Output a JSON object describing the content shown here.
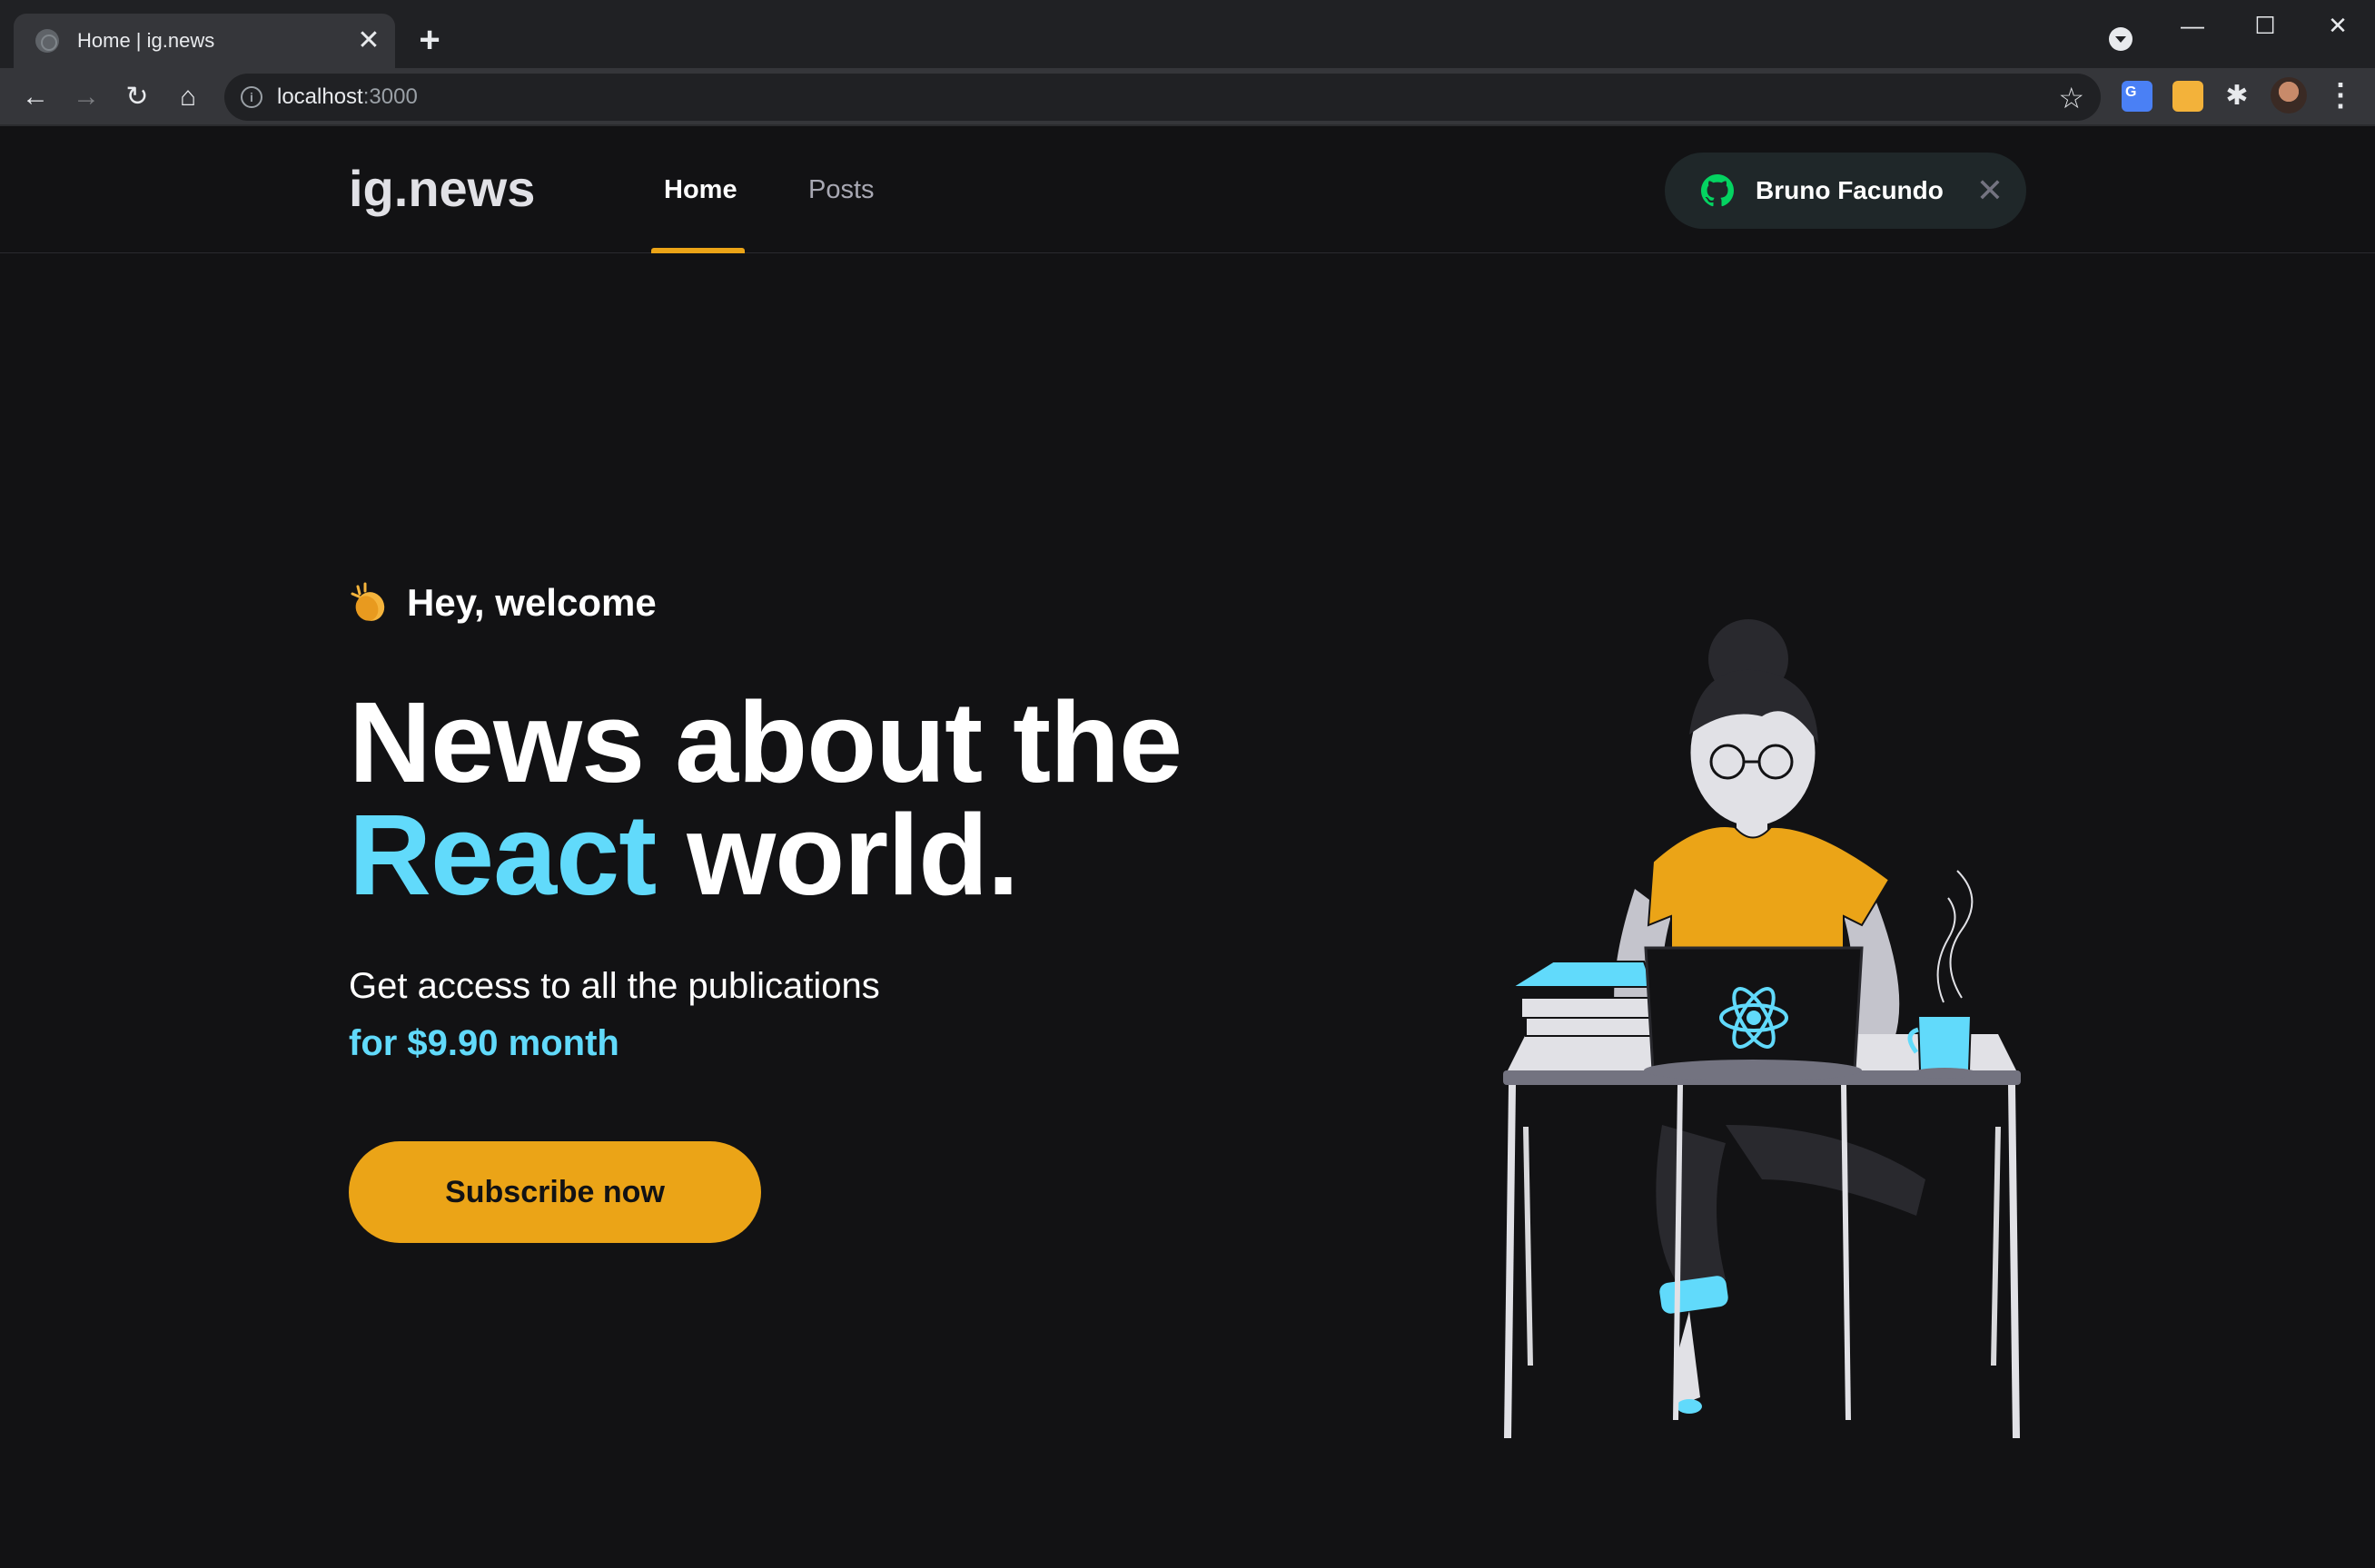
{
  "browser": {
    "tab_title": "Home | ig.news",
    "tab_close": "✕",
    "new_tab": "+",
    "url_host": "localhost",
    "url_port": ":3000",
    "window_minimize": "—",
    "window_maximize": "☐",
    "window_close": "✕"
  },
  "site": {
    "logo": "ig.news",
    "nav": [
      {
        "label": "Home",
        "active": true
      },
      {
        "label": "Posts",
        "active": false
      }
    ],
    "signin": {
      "user_name": "Bruno Facundo",
      "close": "✕"
    }
  },
  "hero": {
    "welcome": "Hey, welcome",
    "headline_line1": "News about the",
    "headline_accent": "React",
    "headline_line2_rest": " world.",
    "subtitle": "Get access to all the publications",
    "price": "for $9.90 month",
    "cta": "Subscribe now"
  },
  "colors": {
    "background": "#121214",
    "accent_yellow": "#eba417",
    "accent_cyan": "#61dafb",
    "github_green": "#04d361"
  },
  "icons": [
    "globe-icon",
    "back-icon",
    "forward-icon",
    "reload-icon",
    "home-icon",
    "info-icon",
    "star-icon",
    "translate-extension-icon",
    "notes-extension-icon",
    "puzzle-icon",
    "kebab-menu-icon",
    "github-icon",
    "close-icon",
    "clap-emoji-icon"
  ]
}
